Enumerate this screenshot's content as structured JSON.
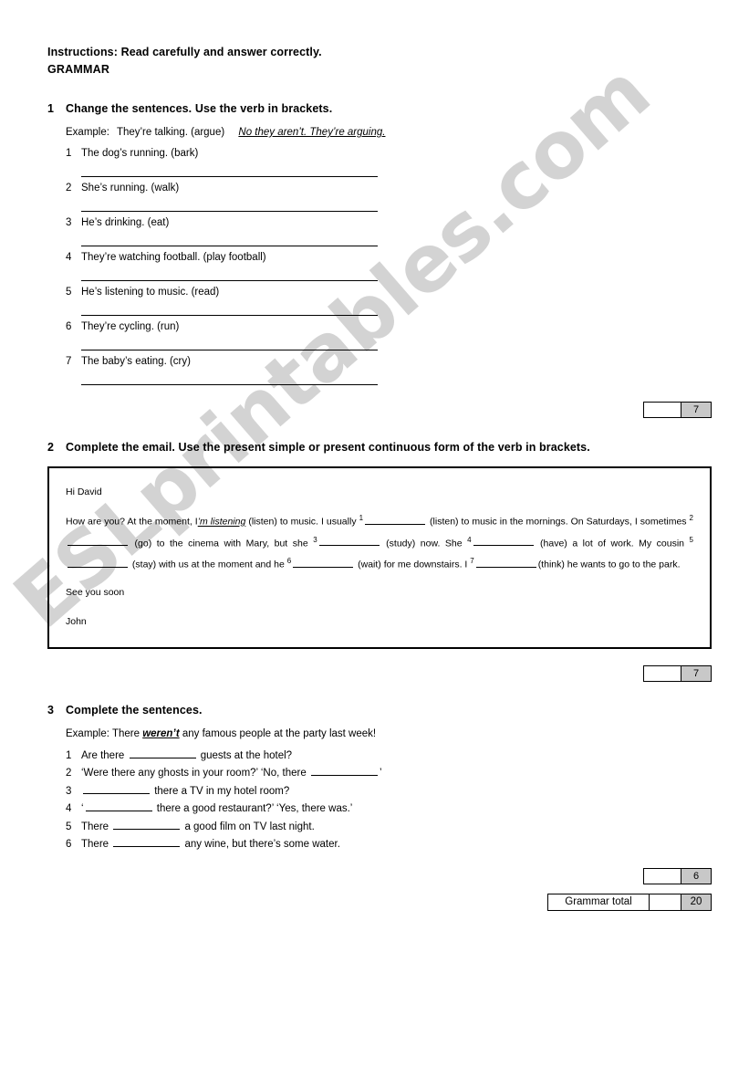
{
  "header": {
    "instructions": "Instructions: Read carefully and answer correctly.",
    "grammar_label": "GRAMMAR"
  },
  "exercise1": {
    "number": "1",
    "title": "Change the sentences. Use the verb in brackets.",
    "example_label": "Example:",
    "example_prompt": "They’re talking. (argue)",
    "example_answer": "No they aren’t. They’re arguing.",
    "items": [
      {
        "n": "1",
        "text": "The dog’s running. (bark)"
      },
      {
        "n": "2",
        "text": "She’s running. (walk)"
      },
      {
        "n": "3",
        "text": "He’s drinking. (eat)"
      },
      {
        "n": "4",
        "text": "They’re watching football. (play football)"
      },
      {
        "n": "5",
        "text": "He’s listening to music. (read)"
      },
      {
        "n": "6",
        "text": "They’re cycling. (run)"
      },
      {
        "n": "7",
        "text": "The baby’s eating. (cry)"
      }
    ],
    "score": "7"
  },
  "exercise2": {
    "number": "2",
    "title": "Complete the email. Use the present simple or present continuous form of the verb in brackets.",
    "email": {
      "greeting": "Hi David",
      "segments": [
        {
          "type": "text",
          "value": "How are you? At the moment, I"
        },
        {
          "type": "answer",
          "value": "’m listening"
        },
        {
          "type": "text",
          "value": " (listen) to music. I usually "
        },
        {
          "type": "sup",
          "value": "1"
        },
        {
          "type": "blank"
        },
        {
          "type": "text",
          "value": " (listen) to music in the mornings. On Saturdays, I sometimes "
        },
        {
          "type": "sup",
          "value": "2"
        },
        {
          "type": "blank"
        },
        {
          "type": "text",
          "value": " (go) to the cinema with Mary, but she "
        },
        {
          "type": "sup",
          "value": "3"
        },
        {
          "type": "blank"
        },
        {
          "type": "text",
          "value": " (study) now. She "
        },
        {
          "type": "sup",
          "value": "4"
        },
        {
          "type": "blank"
        },
        {
          "type": "text",
          "value": " (have) a lot of work. My cousin "
        },
        {
          "type": "sup",
          "value": "5"
        },
        {
          "type": "blank"
        },
        {
          "type": "text",
          "value": " (stay) with us at the moment and he "
        },
        {
          "type": "sup",
          "value": "6"
        },
        {
          "type": "blank"
        },
        {
          "type": "text",
          "value": " (wait) for me downstairs. I "
        },
        {
          "type": "sup",
          "value": "7"
        },
        {
          "type": "blank"
        },
        {
          "type": "text",
          "value": "(think) he wants to go to the park."
        }
      ],
      "sign_off": "See you soon",
      "name": "John"
    },
    "score": "7"
  },
  "exercise3": {
    "number": "3",
    "title": "Complete the sentences.",
    "example_label": "Example:",
    "example_before": "There ",
    "example_answer": "weren’t",
    "example_after": " any famous people at the party last week!",
    "items": [
      {
        "n": "1",
        "before": "Are there ",
        "after": " guests at the hotel?"
      },
      {
        "n": "2",
        "before": "‘Were there any ghosts in your room?’   ‘No, there ",
        "after": "’"
      },
      {
        "n": "3",
        "before": "",
        "after": " there a TV in my hotel room?"
      },
      {
        "n": "4",
        "before": "‘",
        "after": " there a good restaurant?’   ‘Yes, there was.’"
      },
      {
        "n": "5",
        "before": "There ",
        "after": " a good film on TV last night."
      },
      {
        "n": "6",
        "before": "There ",
        "after": " any wine, but there’s some water."
      }
    ],
    "score": "6"
  },
  "total": {
    "label": "Grammar total",
    "value": "20"
  },
  "watermark": {
    "text": "ESLprintables.com"
  }
}
